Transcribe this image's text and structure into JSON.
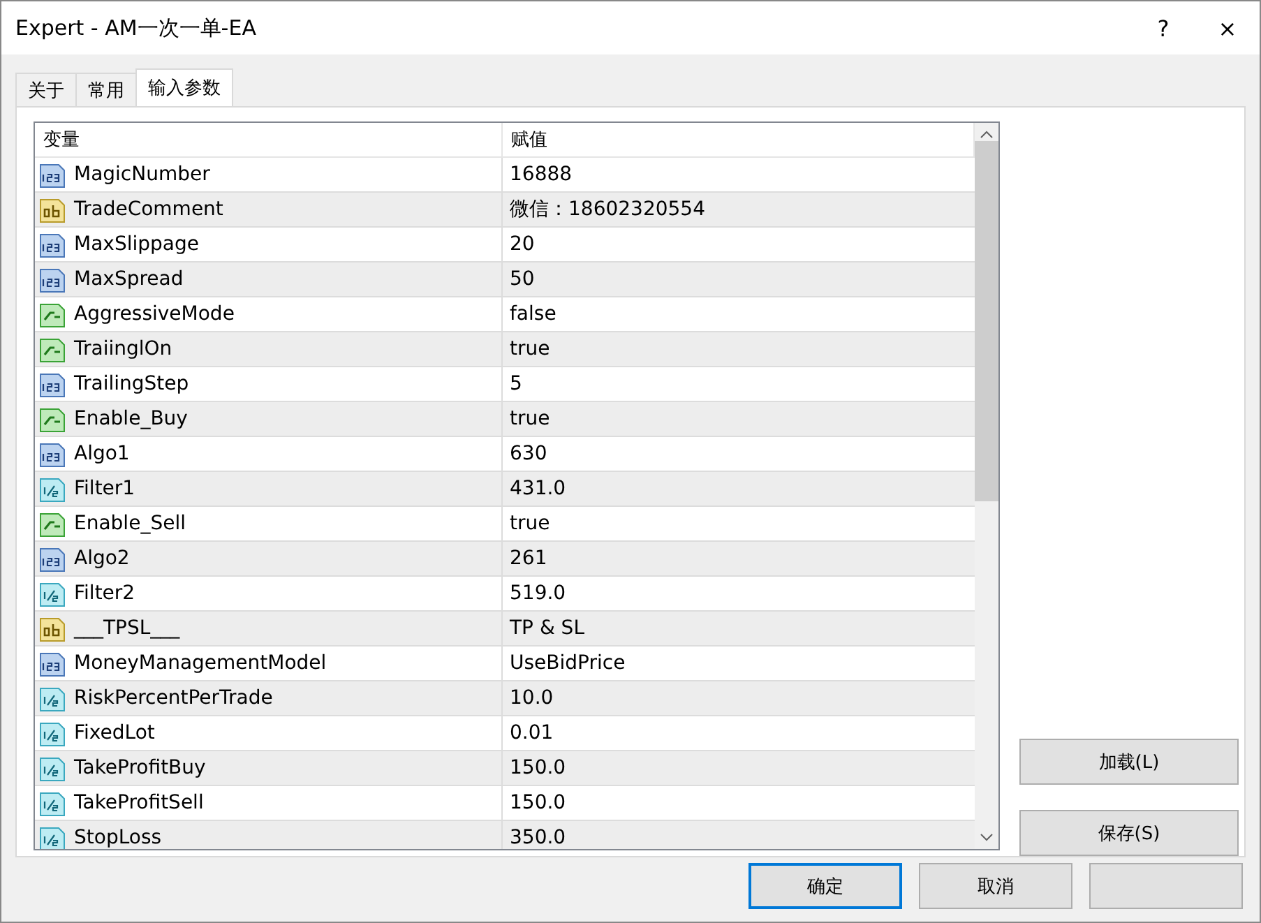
{
  "window": {
    "title": "Expert - AM一次一单-EA",
    "help": "?",
    "close": "×"
  },
  "tabs": [
    {
      "label": "关于",
      "selected": false
    },
    {
      "label": "常用",
      "selected": false
    },
    {
      "label": "输入参数",
      "selected": true
    }
  ],
  "table": {
    "columns": [
      "变量",
      "赋值"
    ],
    "rows": [
      {
        "kind": "int",
        "name": "MagicNumber",
        "value": "16888"
      },
      {
        "kind": "string",
        "name": "TradeComment",
        "value": "微信：18602320554"
      },
      {
        "kind": "int",
        "name": "MaxSlippage",
        "value": "20"
      },
      {
        "kind": "int",
        "name": "MaxSpread",
        "value": "50"
      },
      {
        "kind": "bool",
        "name": "AggressiveMode",
        "value": "false"
      },
      {
        "kind": "bool",
        "name": "TraiinglOn",
        "value": "true"
      },
      {
        "kind": "int",
        "name": "TrailingStep",
        "value": "5"
      },
      {
        "kind": "bool",
        "name": "Enable_Buy",
        "value": "true"
      },
      {
        "kind": "int",
        "name": "Algo1",
        "value": "630"
      },
      {
        "kind": "double",
        "name": "Filter1",
        "value": "431.0"
      },
      {
        "kind": "bool",
        "name": "Enable_Sell",
        "value": "true"
      },
      {
        "kind": "int",
        "name": "Algo2",
        "value": "261"
      },
      {
        "kind": "double",
        "name": "Filter2",
        "value": "519.0"
      },
      {
        "kind": "string",
        "name": "___TPSL___",
        "value": "TP & SL"
      },
      {
        "kind": "int",
        "name": "MoneyManagementModel",
        "value": "UseBidPrice"
      },
      {
        "kind": "double",
        "name": "RiskPercentPerTrade",
        "value": "10.0"
      },
      {
        "kind": "double",
        "name": "FixedLot",
        "value": "0.01"
      },
      {
        "kind": "double",
        "name": "TakeProfitBuy",
        "value": "150.0"
      },
      {
        "kind": "double",
        "name": "TakeProfitSell",
        "value": "150.0"
      },
      {
        "kind": "double",
        "name": "StopLoss",
        "value": "350.0"
      }
    ]
  },
  "side_buttons": [
    "加载(L)",
    "保存(S)"
  ],
  "buttons": [
    {
      "label": "确定",
      "selected": true
    },
    {
      "label": "取消",
      "selected": false
    }
  ]
}
